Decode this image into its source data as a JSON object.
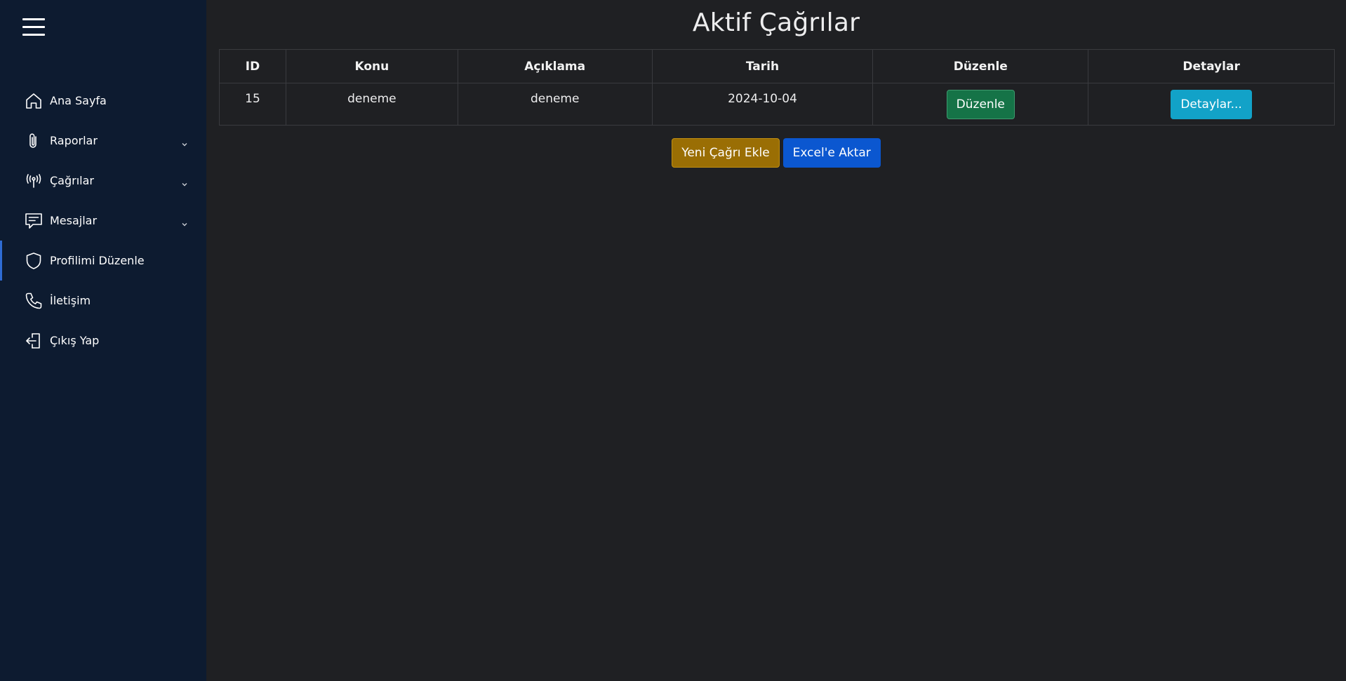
{
  "sidebar": {
    "items": [
      {
        "label": "Ana Sayfa",
        "icon": "home-icon",
        "has_submenu": false
      },
      {
        "label": "Raporlar",
        "icon": "paperclip-icon",
        "has_submenu": true
      },
      {
        "label": "Çağrılar",
        "icon": "broadcast-icon",
        "has_submenu": true
      },
      {
        "label": "Mesajlar",
        "icon": "message-icon",
        "has_submenu": true
      },
      {
        "label": "Profilimi Düzenle",
        "icon": "shield-icon",
        "has_submenu": false,
        "active": true
      },
      {
        "label": "İletişim",
        "icon": "phone-icon",
        "has_submenu": false
      },
      {
        "label": "Çıkış Yap",
        "icon": "logout-icon",
        "has_submenu": false
      }
    ]
  },
  "main": {
    "title": "Aktif Çağrılar",
    "table": {
      "headers": [
        "ID",
        "Konu",
        "Açıklama",
        "Tarih",
        "Düzenle",
        "Detaylar"
      ],
      "rows": [
        {
          "id": "15",
          "konu": "deneme",
          "aciklama": "deneme",
          "tarih": "2024-10-04",
          "edit_label": "Düzenle",
          "details_label": "Detaylar..."
        }
      ]
    },
    "actions": {
      "new_call_label": "Yeni Çağrı Ekle",
      "export_label": "Excel'e Aktar"
    }
  },
  "colors": {
    "sidebar_bg": "#0d1b30",
    "main_bg": "#1f2023",
    "active_indicator": "#2f6cd4",
    "edit_button": "#157347",
    "details_button": "#12a2c8",
    "new_call_button": "#9a6e04",
    "export_button": "#0b57d0"
  }
}
